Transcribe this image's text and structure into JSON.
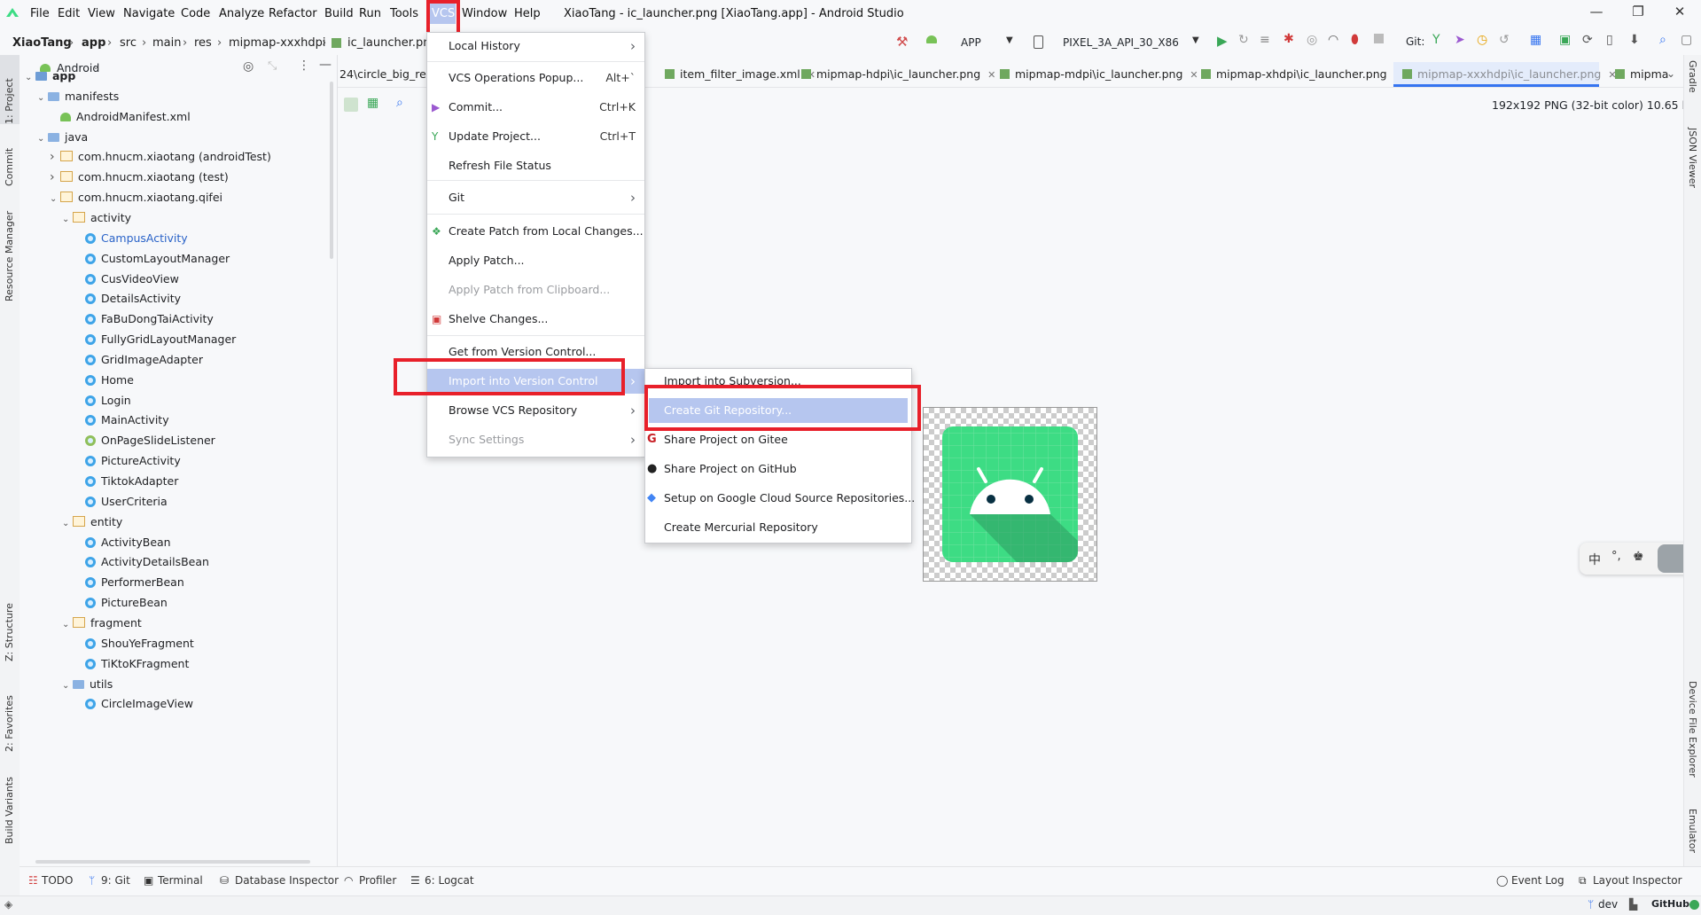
{
  "menubar": {
    "items": [
      "File",
      "Edit",
      "View",
      "Navigate",
      "Code",
      "Analyze",
      "Refactor",
      "Build",
      "Run",
      "Tools",
      "VCS",
      "Window",
      "Help"
    ],
    "title": "XiaoTang - ic_launcher.png [XiaoTang.app] - Android Studio",
    "minimize": "—",
    "restore": "❐",
    "close": "✕"
  },
  "breadcrumb": [
    "XiaoTang",
    "app",
    "src",
    "main",
    "res",
    "mipmap-xxxhdpi",
    "ic_launcher.png"
  ],
  "run_toolbar": {
    "config": "APP",
    "device": "PIXEL_3A_API_30_X86",
    "git_label": "Git:"
  },
  "project_panel": {
    "view_selector": "Android",
    "tree": [
      {
        "label": "app",
        "depth": 0,
        "kind": "module",
        "arrow": "open",
        "bold": true
      },
      {
        "label": "manifests",
        "depth": 1,
        "kind": "folder",
        "arrow": "open"
      },
      {
        "label": "AndroidManifest.xml",
        "depth": 2,
        "kind": "manifest",
        "arrow": "none"
      },
      {
        "label": "java",
        "depth": 1,
        "kind": "folder",
        "arrow": "open"
      },
      {
        "label": "com.hnucm.xiaotang (androidTest)",
        "depth": 2,
        "kind": "package",
        "arrow": "closed"
      },
      {
        "label": "com.hnucm.xiaotang (test)",
        "depth": 2,
        "kind": "package",
        "arrow": "closed"
      },
      {
        "label": "com.hnucm.xiaotang.qifei",
        "depth": 2,
        "kind": "package",
        "arrow": "open"
      },
      {
        "label": "activity",
        "depth": 3,
        "kind": "package",
        "arrow": "open"
      },
      {
        "label": "CampusActivity",
        "depth": 4,
        "kind": "class",
        "arrow": "none",
        "link": true
      },
      {
        "label": "CustomLayoutManager",
        "depth": 4,
        "kind": "class",
        "arrow": "none"
      },
      {
        "label": "CusVideoView",
        "depth": 4,
        "kind": "class",
        "arrow": "none"
      },
      {
        "label": "DetailsActivity",
        "depth": 4,
        "kind": "class",
        "arrow": "none"
      },
      {
        "label": "FaBuDongTaiActivity",
        "depth": 4,
        "kind": "class",
        "arrow": "none"
      },
      {
        "label": "FullyGridLayoutManager",
        "depth": 4,
        "kind": "class",
        "arrow": "none"
      },
      {
        "label": "GridImageAdapter",
        "depth": 4,
        "kind": "class",
        "arrow": "none"
      },
      {
        "label": "Home",
        "depth": 4,
        "kind": "class",
        "arrow": "none"
      },
      {
        "label": "Login",
        "depth": 4,
        "kind": "class",
        "arrow": "none"
      },
      {
        "label": "MainActivity",
        "depth": 4,
        "kind": "class",
        "arrow": "none"
      },
      {
        "label": "OnPageSlideListener",
        "depth": 4,
        "kind": "interface",
        "arrow": "none"
      },
      {
        "label": "PictureActivity",
        "depth": 4,
        "kind": "class",
        "arrow": "none"
      },
      {
        "label": "TiktokAdapter",
        "depth": 4,
        "kind": "class",
        "arrow": "none"
      },
      {
        "label": "UserCriteria",
        "depth": 4,
        "kind": "class",
        "arrow": "none"
      },
      {
        "label": "entity",
        "depth": 3,
        "kind": "package",
        "arrow": "open"
      },
      {
        "label": "ActivityBean",
        "depth": 4,
        "kind": "class",
        "arrow": "none"
      },
      {
        "label": "ActivityDetailsBean",
        "depth": 4,
        "kind": "class",
        "arrow": "none"
      },
      {
        "label": "PerformerBean",
        "depth": 4,
        "kind": "class",
        "arrow": "none"
      },
      {
        "label": "PictureBean",
        "depth": 4,
        "kind": "class",
        "arrow": "none"
      },
      {
        "label": "fragment",
        "depth": 3,
        "kind": "package",
        "arrow": "open"
      },
      {
        "label": "ShouYeFragment",
        "depth": 4,
        "kind": "class",
        "arrow": "none"
      },
      {
        "label": "TiKtoKFragment",
        "depth": 4,
        "kind": "class",
        "arrow": "none"
      },
      {
        "label": "utils",
        "depth": 3,
        "kind": "folder",
        "arrow": "open"
      },
      {
        "label": "CircleImageView",
        "depth": 4,
        "kind": "class",
        "arrow": "none"
      }
    ]
  },
  "left_stripe": [
    "1: Project",
    "Commit",
    "Resource Manager",
    "Z: Structure",
    "2: Favorites",
    "Build Variants"
  ],
  "right_stripe": [
    "Gradle",
    "JSON Viewer",
    "Device File Explorer",
    "Emulator"
  ],
  "editor_tabs": [
    {
      "label": "24\\circle_big_red",
      "close": false
    },
    {
      "label": "item_filter_image.xml",
      "close": true
    },
    {
      "label": "mipmap-hdpi\\ic_launcher.png",
      "close": true
    },
    {
      "label": "mipmap-mdpi\\ic_launcher.png",
      "close": true
    },
    {
      "label": "mipmap-xhdpi\\ic_launcher.png",
      "close": true
    },
    {
      "label": "mipmap-xxxhdpi\\ic_launcher.png",
      "close": true,
      "active": true
    },
    {
      "label": "mipma",
      "close": false
    }
  ],
  "image_info": "192x192 PNG (32-bit color) 10.65 kB",
  "vcs_menu": {
    "items": [
      {
        "label": "Local History",
        "submenu": true
      },
      {
        "label": "VCS Operations Popup...",
        "shortcut": "Alt+`"
      },
      {
        "label": "Commit...",
        "shortcut": "Ctrl+K"
      },
      {
        "label": "Update Project...",
        "shortcut": "Ctrl+T"
      },
      {
        "label": "Refresh File Status"
      },
      {
        "label": "Git",
        "submenu": true
      },
      {
        "label": "Create Patch from Local Changes..."
      },
      {
        "label": "Apply Patch..."
      },
      {
        "label": "Apply Patch from Clipboard...",
        "disabled": true
      },
      {
        "label": "Shelve Changes..."
      },
      {
        "label": "Get from Version Control..."
      },
      {
        "label": "Import into Version Control",
        "submenu": true,
        "highlighted": true
      },
      {
        "label": "Browse VCS Repository",
        "submenu": true
      },
      {
        "label": "Sync Settings",
        "submenu": true,
        "disabled": true
      }
    ]
  },
  "import_submenu": {
    "items": [
      {
        "label": "Import into Subversion..."
      },
      {
        "label": "Create Git Repository...",
        "highlighted": true
      },
      {
        "label": "Share Project on Gitee"
      },
      {
        "label": "Share Project on GitHub"
      },
      {
        "label": "Setup on Google Cloud Source Repositories..."
      },
      {
        "label": "Create Mercurial Repository"
      }
    ]
  },
  "bottom_tools": [
    "TODO",
    "9: Git",
    "Terminal",
    "Database Inspector",
    "Profiler",
    "6: Logcat"
  ],
  "bottom_right_tools": [
    "Event Log",
    "Layout Inspector"
  ],
  "status_bar": {
    "branch": "dev",
    "github": "GitHub"
  },
  "ime": {
    "char": "中",
    "punct": "°,"
  },
  "colors": {
    "accent": "#3574f0",
    "highlight": "#b6c6ef",
    "red_box": "#e8202a",
    "android_green": "#3ddc84"
  }
}
